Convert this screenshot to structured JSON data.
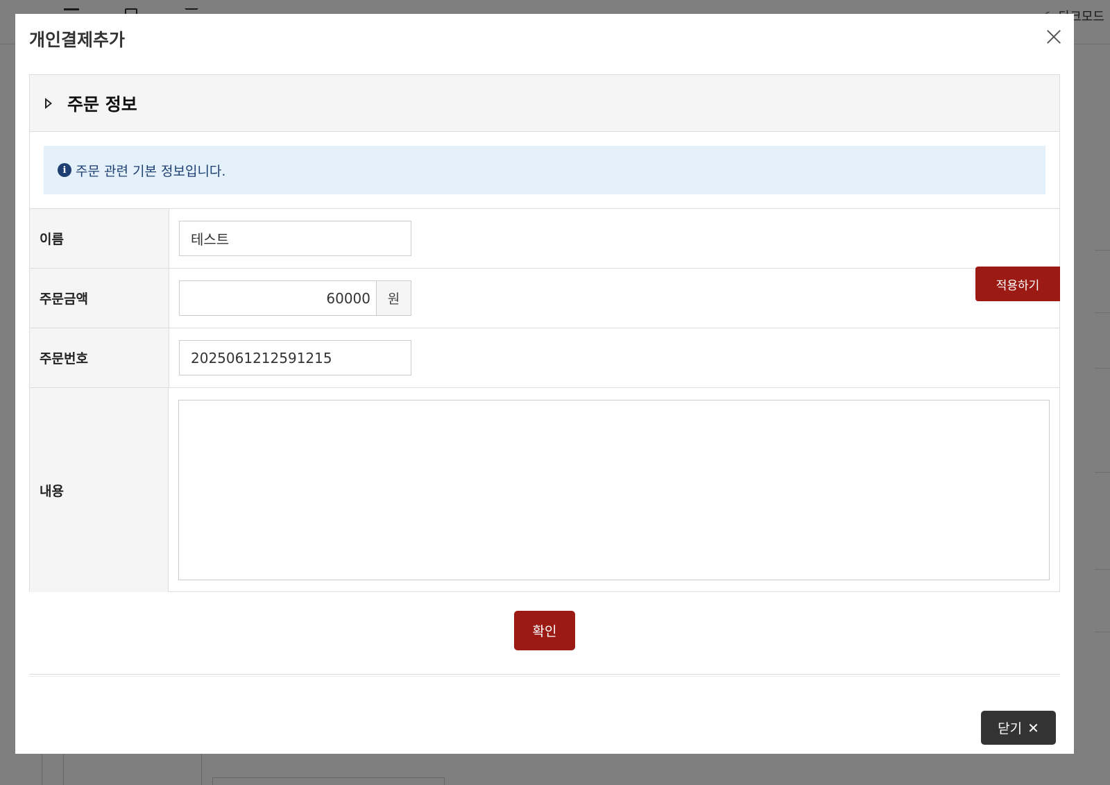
{
  "background": {
    "dark_mode_label": "다크모드"
  },
  "modal": {
    "title": "개인결제추가"
  },
  "panel": {
    "title": "주문 정보",
    "info_message": "주문 관련 기본 정보입니다."
  },
  "form": {
    "name": {
      "label": "이름",
      "value": "테스트"
    },
    "amount": {
      "label": "주문금액",
      "value": "60000",
      "unit": "원",
      "apply_label": "적용하기"
    },
    "order_no": {
      "label": "주문번호",
      "value": "2025061212591215"
    },
    "content": {
      "label": "내용",
      "value": ""
    }
  },
  "actions": {
    "confirm_label": "확인",
    "close_label": "닫기"
  },
  "icons": {
    "close": "close-icon",
    "expand": "triangle-right-icon",
    "info": "info-circle-icon",
    "x": "x-icon"
  },
  "colors": {
    "primary_red": "#9b1b14",
    "dark_button": "#333333",
    "info_bg": "#e4f1fb",
    "info_text": "#1d3f72"
  }
}
